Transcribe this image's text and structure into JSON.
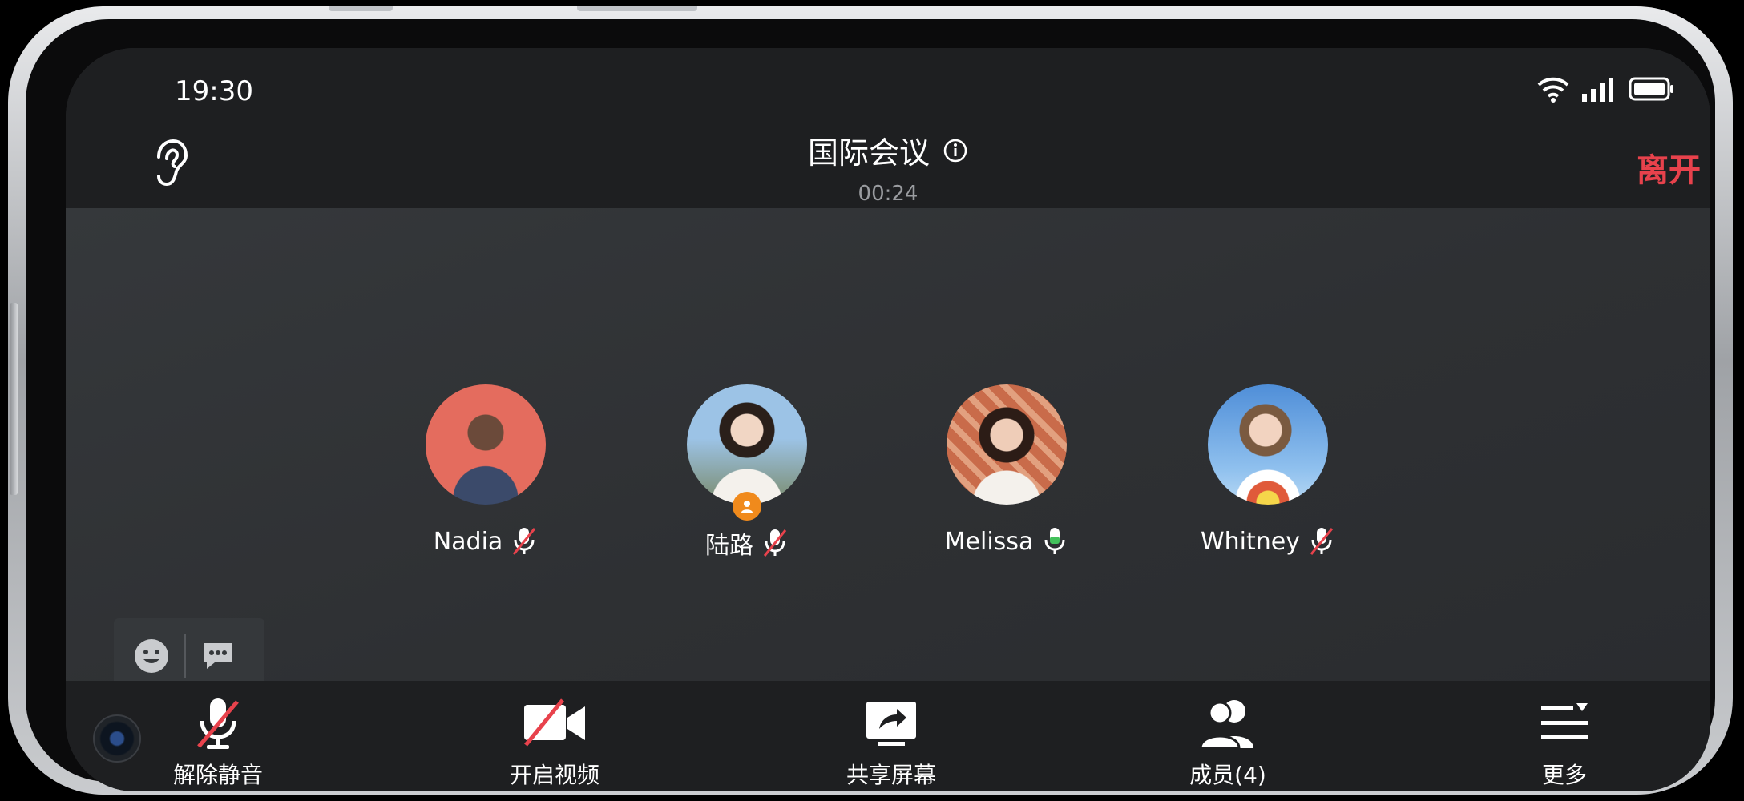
{
  "status": {
    "time": "19:30"
  },
  "header": {
    "title": "国际会议",
    "timer": "00:24",
    "leave_label": "离开"
  },
  "participants": [
    {
      "name": "Nadia",
      "mic": "muted",
      "avatar_color": "#e46c5e",
      "host": false
    },
    {
      "name": "陆路",
      "mic": "muted",
      "avatar_color": "#8fb0c9",
      "host": true
    },
    {
      "name": "Melissa",
      "mic": "active",
      "avatar_color": "#c96b4a",
      "host": false
    },
    {
      "name": "Whitney",
      "mic": "muted",
      "avatar_color": "#6ea3d6",
      "host": false
    }
  ],
  "toolbar": {
    "unmute_label": "解除静音",
    "video_label": "开启视频",
    "share_label": "共享屏幕",
    "members_label": "成员(4)",
    "more_label": "更多"
  },
  "colors": {
    "leave": "#e8424c",
    "mic_active": "#43c15b",
    "mic_muted_slash": "#e8424c",
    "host_badge": "#f08a1c"
  },
  "icons": [
    "ear-icon",
    "info-icon",
    "wifi-icon",
    "signal-icon",
    "battery-icon",
    "emoji-icon",
    "chat-icon",
    "mic-muted-icon",
    "video-off-icon",
    "share-screen-icon",
    "members-icon",
    "more-icon"
  ]
}
